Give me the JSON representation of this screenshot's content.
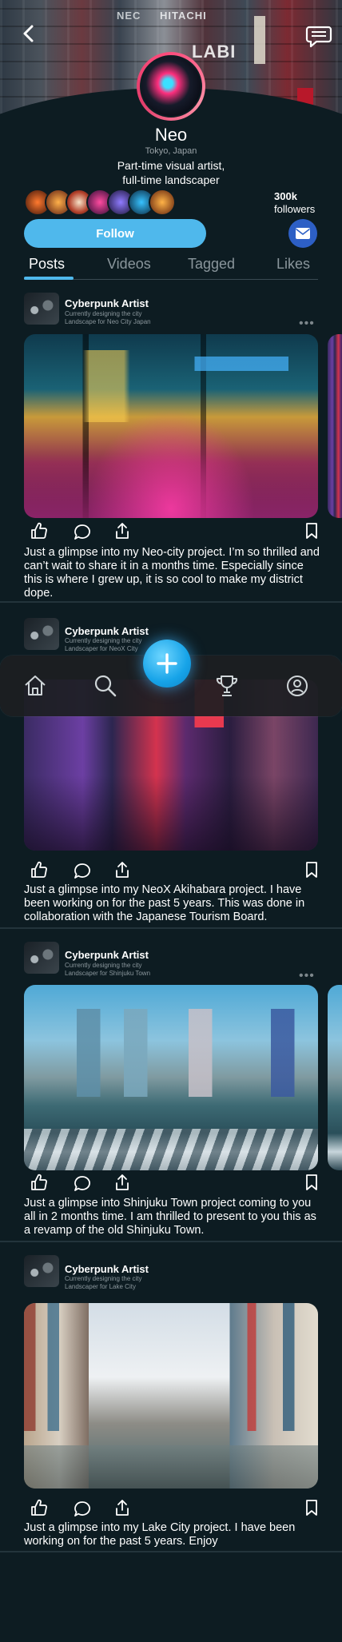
{
  "profile": {
    "name": "Neo",
    "location": "Tokyo, Japan",
    "bio_line1": "Part-time visual artist,",
    "bio_line2": "full-time landscaper",
    "followers_count": "300k",
    "followers_label": "followers",
    "follow_label": "Follow"
  },
  "hero": {
    "signs": [
      "NEC",
      "HITACHI",
      "LABI"
    ]
  },
  "tabs": [
    {
      "label": "Posts",
      "active": true
    },
    {
      "label": "Videos",
      "active": false
    },
    {
      "label": "Tagged",
      "active": false
    },
    {
      "label": "Likes",
      "active": false
    }
  ],
  "posts": [
    {
      "author": "Cyberpunk Artist",
      "sub1": "Currently designing the city",
      "sub2": "Landscape for Neo City Japan",
      "caption": "Just a glimpse into my Neo-city project. I’m so thrilled and can’t wait to share it in a months time. Especially since this is where I grew up, it is so cool to make my district dope."
    },
    {
      "author": "Cyberpunk Artist",
      "sub1": "Currently designing the city",
      "sub2": "Landscaper for NeoX City",
      "caption": "Just a glimpse into my NeoX Akihabara project. I have been working on for the past 5 years. This was done in collaboration with the Japanese Tourism Board."
    },
    {
      "author": "Cyberpunk Artist",
      "sub1": "Currently designing the city",
      "sub2": "Landscaper for Shinjuku Town",
      "caption": "Just a glimpse into Shinjuku Town project coming to you all in 2 months time. I am thrilled to present to you this as a revamp of the old Shinjuku Town."
    },
    {
      "author": "Cyberpunk Artist",
      "sub1": "Currently designing the city",
      "sub2": "Landscaper for Lake City",
      "caption": "Just a glimpse into my Lake City project. I have been working on for the past 5 years. Enjoy"
    }
  ],
  "nav": {
    "items": [
      "home-icon",
      "search-icon",
      "add-icon",
      "trophy-icon",
      "profile-icon"
    ]
  },
  "colors": {
    "accent": "#4fb8ec",
    "background": "#0d1c22",
    "mail": "#2d5fc5",
    "ring": "#ff4d7d"
  }
}
